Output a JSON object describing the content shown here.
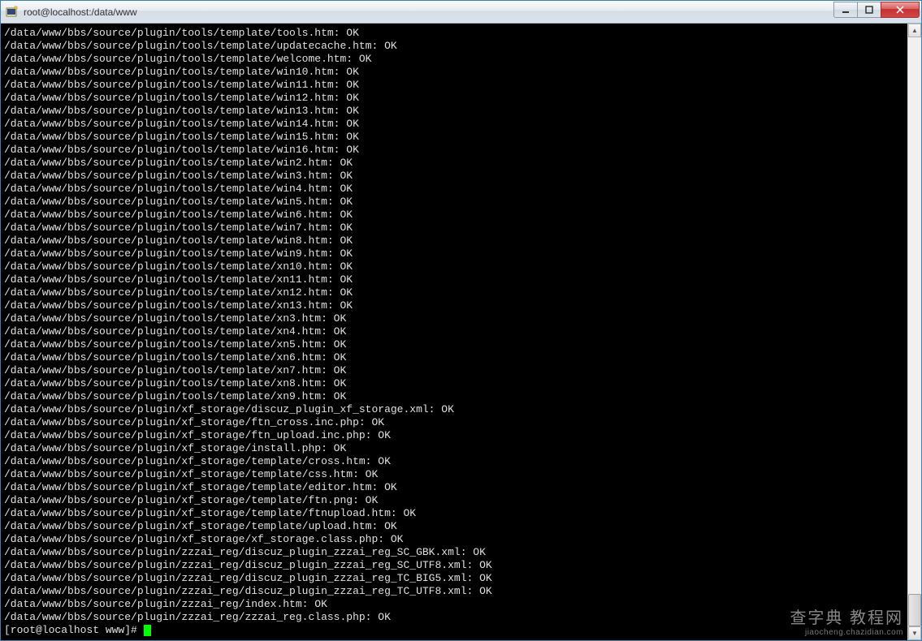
{
  "window": {
    "title": "root@localhost:/data/www"
  },
  "terminal": {
    "lines": [
      "/data/www/bbs/source/plugin/tools/template/tools.htm: OK",
      "/data/www/bbs/source/plugin/tools/template/updatecache.htm: OK",
      "/data/www/bbs/source/plugin/tools/template/welcome.htm: OK",
      "/data/www/bbs/source/plugin/tools/template/win10.htm: OK",
      "/data/www/bbs/source/plugin/tools/template/win11.htm: OK",
      "/data/www/bbs/source/plugin/tools/template/win12.htm: OK",
      "/data/www/bbs/source/plugin/tools/template/win13.htm: OK",
      "/data/www/bbs/source/plugin/tools/template/win14.htm: OK",
      "/data/www/bbs/source/plugin/tools/template/win15.htm: OK",
      "/data/www/bbs/source/plugin/tools/template/win16.htm: OK",
      "/data/www/bbs/source/plugin/tools/template/win2.htm: OK",
      "/data/www/bbs/source/plugin/tools/template/win3.htm: OK",
      "/data/www/bbs/source/plugin/tools/template/win4.htm: OK",
      "/data/www/bbs/source/plugin/tools/template/win5.htm: OK",
      "/data/www/bbs/source/plugin/tools/template/win6.htm: OK",
      "/data/www/bbs/source/plugin/tools/template/win7.htm: OK",
      "/data/www/bbs/source/plugin/tools/template/win8.htm: OK",
      "/data/www/bbs/source/plugin/tools/template/win9.htm: OK",
      "/data/www/bbs/source/plugin/tools/template/xn10.htm: OK",
      "/data/www/bbs/source/plugin/tools/template/xn11.htm: OK",
      "/data/www/bbs/source/plugin/tools/template/xn12.htm: OK",
      "/data/www/bbs/source/plugin/tools/template/xn13.htm: OK",
      "/data/www/bbs/source/plugin/tools/template/xn3.htm: OK",
      "/data/www/bbs/source/plugin/tools/template/xn4.htm: OK",
      "/data/www/bbs/source/plugin/tools/template/xn5.htm: OK",
      "/data/www/bbs/source/plugin/tools/template/xn6.htm: OK",
      "/data/www/bbs/source/plugin/tools/template/xn7.htm: OK",
      "/data/www/bbs/source/plugin/tools/template/xn8.htm: OK",
      "/data/www/bbs/source/plugin/tools/template/xn9.htm: OK",
      "/data/www/bbs/source/plugin/xf_storage/discuz_plugin_xf_storage.xml: OK",
      "/data/www/bbs/source/plugin/xf_storage/ftn_cross.inc.php: OK",
      "/data/www/bbs/source/plugin/xf_storage/ftn_upload.inc.php: OK",
      "/data/www/bbs/source/plugin/xf_storage/install.php: OK",
      "/data/www/bbs/source/plugin/xf_storage/template/cross.htm: OK",
      "/data/www/bbs/source/plugin/xf_storage/template/css.htm: OK",
      "/data/www/bbs/source/plugin/xf_storage/template/editor.htm: OK",
      "/data/www/bbs/source/plugin/xf_storage/template/ftn.png: OK",
      "/data/www/bbs/source/plugin/xf_storage/template/ftnupload.htm: OK",
      "/data/www/bbs/source/plugin/xf_storage/template/upload.htm: OK",
      "/data/www/bbs/source/plugin/xf_storage/xf_storage.class.php: OK",
      "/data/www/bbs/source/plugin/zzzai_reg/discuz_plugin_zzzai_reg_SC_GBK.xml: OK",
      "/data/www/bbs/source/plugin/zzzai_reg/discuz_plugin_zzzai_reg_SC_UTF8.xml: OK",
      "/data/www/bbs/source/plugin/zzzai_reg/discuz_plugin_zzzai_reg_TC_BIG5.xml: OK",
      "/data/www/bbs/source/plugin/zzzai_reg/discuz_plugin_zzzai_reg_TC_UTF8.xml: OK",
      "/data/www/bbs/source/plugin/zzzai_reg/index.htm: OK",
      "/data/www/bbs/source/plugin/zzzai_reg/zzzai_reg.class.php: OK"
    ],
    "prompt": "[root@localhost www]# "
  },
  "watermark": {
    "main": "查字典 教程网",
    "sub": "jiaocheng.chazidian.com"
  }
}
